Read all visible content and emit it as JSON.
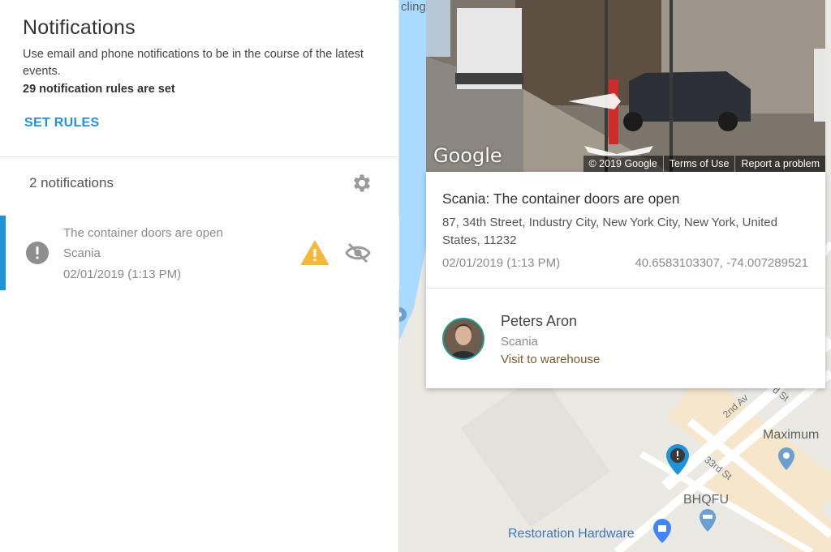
{
  "panel": {
    "title": "Notifications",
    "description": "Use email and phone notifications to be in the course of the latest events.",
    "rules_count": "29 notification rules are set",
    "set_rules_label": "SET RULES"
  },
  "notifications": {
    "count_label": "2 notifications",
    "items": [
      {
        "title": "The container doors are open",
        "subtitle": "Scania",
        "date": "02/01/2019 (1:13 PM)"
      }
    ]
  },
  "streetview": {
    "logo": "Google",
    "footer": [
      "© 2019 Google",
      "Terms of Use",
      "Report a problem"
    ]
  },
  "card": {
    "title": "Scania: The container doors are open",
    "address": "87, 34th Street, Industry City, New York City, New York, United States, 11232",
    "date": "02/01/2019 (1:13 PM)",
    "coordinates": "40.6583103307, -74.007289521",
    "driver": {
      "name": "Peters Aron",
      "company": "Scania",
      "task": "Visit to warehouse"
    }
  },
  "map": {
    "labels": {
      "cling": "cling",
      "maximum": "Maximum",
      "bhqfu": "BHQFU",
      "restoration": "Restoration Hardware",
      "street_33rd": "33rd St",
      "street_2nd": "2nd Av",
      "street_st": "d St"
    }
  },
  "colors": {
    "accent": "#1f93d8",
    "warning": "#f5b83d",
    "task_link": "#7a5a2e",
    "water": "#aadaff",
    "map_land": "#ebe9e4"
  }
}
